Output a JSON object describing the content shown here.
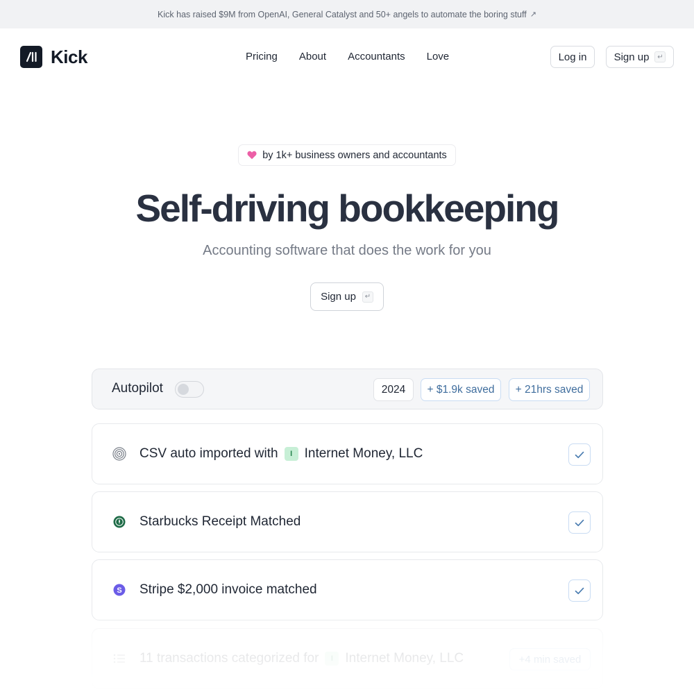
{
  "announcement": {
    "text": "Kick has raised $9M from OpenAI, General Catalyst and 50+ angels to automate the boring stuff",
    "icon": "arrow-up-right-icon",
    "arrow": "↗"
  },
  "nav": {
    "brand": "Kick",
    "logo_icon": "kick-logo-icon",
    "links": [
      "Pricing",
      "About",
      "Accountants",
      "Love"
    ],
    "login_label": "Log in",
    "signup_label": "Sign up",
    "enter_key": "↵"
  },
  "hero": {
    "badge_text": "by 1k+ business owners and accountants",
    "badge_icon": "heart-icon",
    "title": "Self-driving bookkeeping",
    "subtitle": "Accounting software that does the work for you",
    "cta_label": "Sign up",
    "cta_key": "↵"
  },
  "demo": {
    "autopilot_label": "Autopilot",
    "autopilot_on": false,
    "year": "2024",
    "saved_money": "+ $1.9k saved",
    "saved_time": "+ 21hrs saved",
    "rows": [
      {
        "icon": "csv-import-icon",
        "text": "CSV auto imported with",
        "tag": "I",
        "entity": "Internet Money, LLC",
        "status": "check-icon"
      },
      {
        "icon": "starbucks-icon",
        "text": "Starbucks Receipt Matched",
        "status": "check-icon"
      },
      {
        "icon": "stripe-icon",
        "text": "Stripe $2,000 invoice matched",
        "status": "check-icon"
      },
      {
        "icon": "list-icon",
        "text": "11 transactions categorized for",
        "tag": "I",
        "entity": "Internet Money, LLC",
        "saved": "+4 min saved"
      }
    ]
  },
  "colors": {
    "accent": "#3f6d9d",
    "heart": "#ec5fa6",
    "brand_dark": "#131a26",
    "stripe": "#6b5ce7",
    "starbucks": "#1e6b47",
    "tag_bg": "#c7efd6"
  }
}
